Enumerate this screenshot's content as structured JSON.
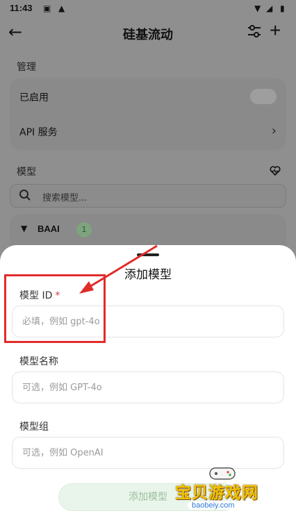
{
  "status_bar": {
    "time": "11:43"
  },
  "app_bar": {
    "title": "硅基流动"
  },
  "manage": {
    "section_label": "管理",
    "enabled_label": "已启用",
    "api_service_label": "API 服务"
  },
  "models": {
    "section_label": "模型",
    "search_placeholder": "搜索模型...",
    "provider_name": "BAAI",
    "provider_count": "1"
  },
  "sheet": {
    "title": "添加模型",
    "model_id_label": "模型 ID",
    "required_mark": "*",
    "model_id_placeholder": "必填，例如 gpt-4o",
    "model_name_label": "模型名称",
    "model_name_placeholder": "可选，例如 GPT-4o",
    "model_group_label": "模型组",
    "model_group_placeholder": "可选，例如 OpenAI",
    "submit_label": "添加模型"
  },
  "watermark": {
    "title": "宝贝游戏网",
    "url": "baobeiy.com"
  },
  "colors": {
    "highlight": "#e22b2b",
    "accent_green": "#9cbf9f",
    "required": "#d23b3b"
  },
  "icons": [
    "back-arrow-icon",
    "filter-icon",
    "plus-icon",
    "search-icon",
    "heart-pulse-icon",
    "chevron-right-icon",
    "caret-down-icon",
    "wifi-icon",
    "battery-icon",
    "warning-icon"
  ]
}
